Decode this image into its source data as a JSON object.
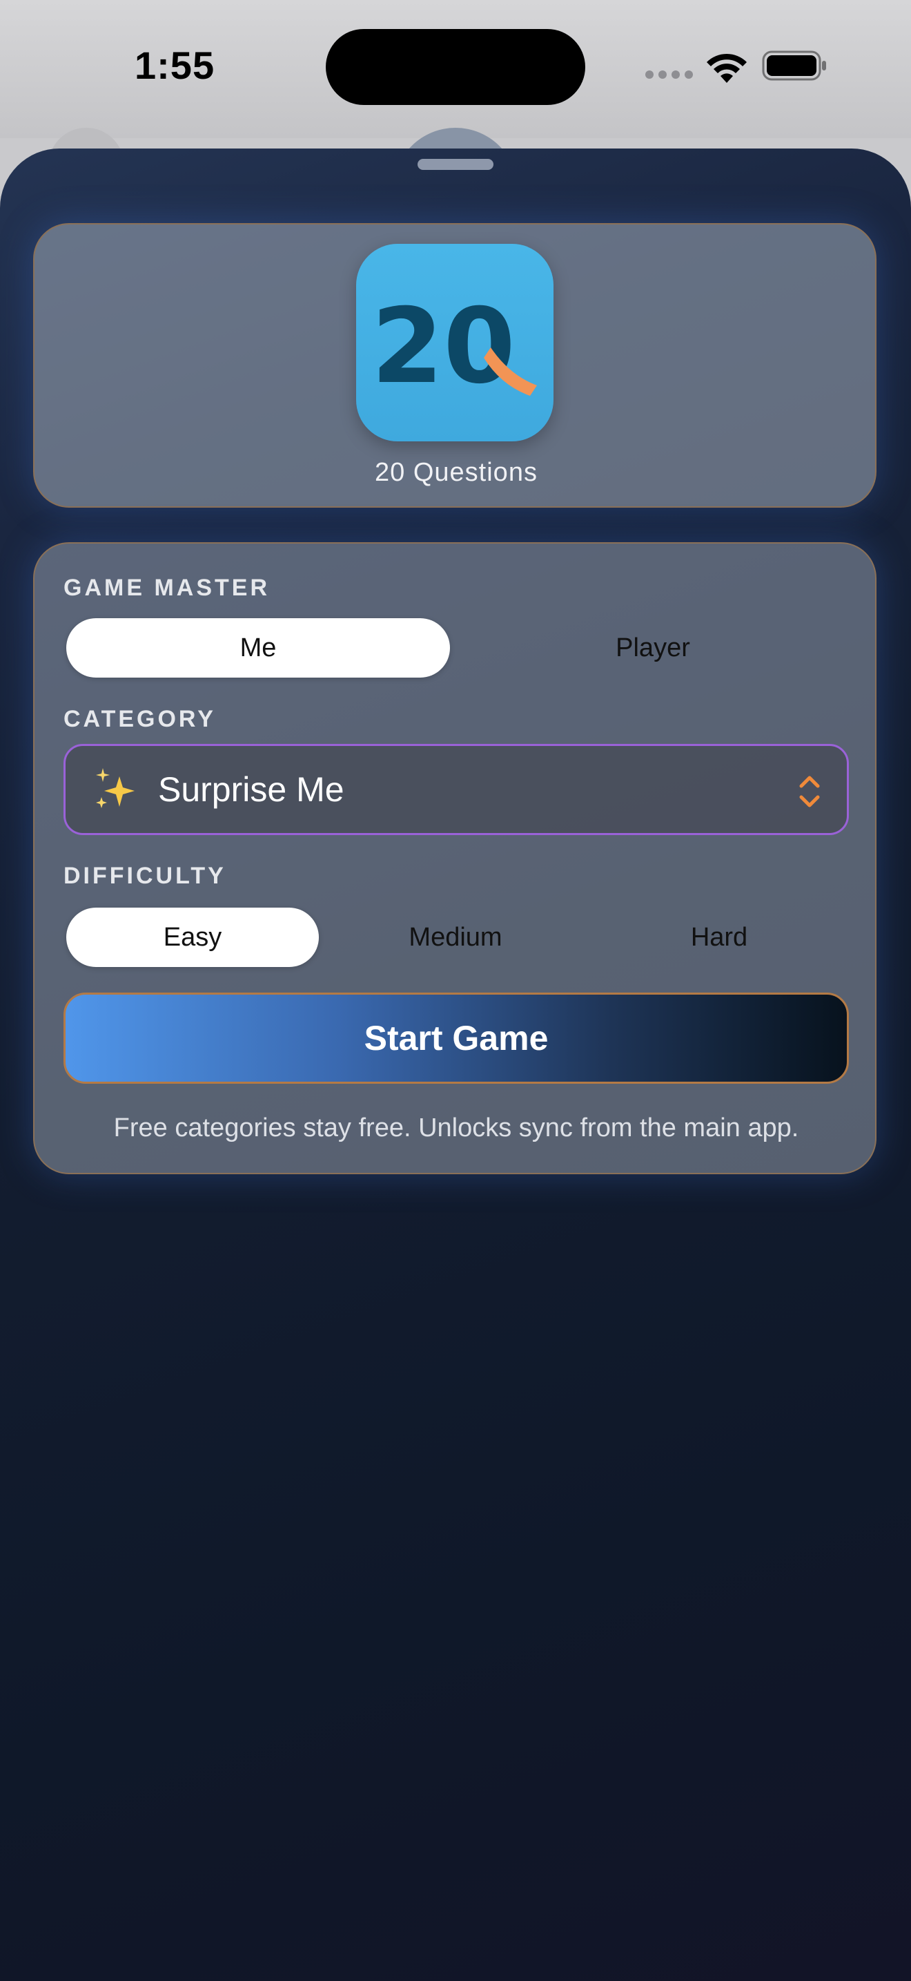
{
  "status_bar": {
    "time": "1:55"
  },
  "header": {
    "app_name": "20 Questions",
    "icon_text": "20",
    "icon_letter": "Q"
  },
  "game_master": {
    "label": "GAME MASTER",
    "options": [
      "Me",
      "Player"
    ],
    "selected": "Me"
  },
  "category": {
    "label": "CATEGORY",
    "icon": "sparkles-icon",
    "value": "Surprise Me"
  },
  "difficulty": {
    "label": "DIFFICULTY",
    "options": [
      "Easy",
      "Medium",
      "Hard"
    ],
    "selected": "Easy"
  },
  "start_button": {
    "label": "Start Game"
  },
  "footnote": "Free categories stay free. Unlocks sync from the main app.",
  "colors": {
    "accent_orange": "#f08a3a",
    "picker_border": "#9a62d8",
    "button_gradient_start": "#5096ea",
    "button_gradient_end": "#07121d",
    "app_icon_bg": "#45b0e4"
  }
}
